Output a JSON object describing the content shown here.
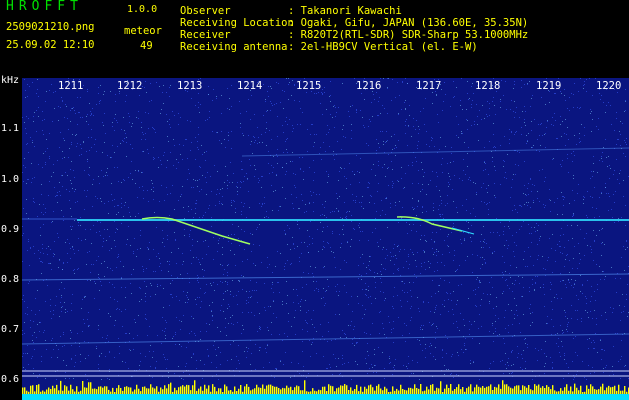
{
  "header": {
    "logo": "HROFFT",
    "version": "1.0.0",
    "file_name": "2509021210.png",
    "meteor_label": "meteor",
    "date_time": "25.09.02 12:10",
    "meteor_count": "49",
    "info": [
      {
        "label": "Observer",
        "value": ": Takanori Kawachi"
      },
      {
        "label": "Receiving Location",
        "value": ": Ogaki, Gifu, JAPAN (136.60E, 35.35N)"
      },
      {
        "label": "Receiver",
        "value": ": R820T2(RTL-SDR) SDR-Sharp 53.1000MHz"
      },
      {
        "label": "Receiving antenna",
        "value": ": 2el-HB9CV Vertical (el. E-W)"
      }
    ]
  },
  "spectrogram": {
    "unit": "kHz",
    "time_ticks": [
      "1211",
      "1212",
      "1213",
      "1214",
      "1215",
      "1216",
      "1217",
      "1218",
      "1219",
      "1220"
    ],
    "freq_ticks": [
      "1.1",
      "1.0",
      "0.9",
      "0.8",
      "0.7",
      "0.6"
    ],
    "colors": {
      "background": "#0a1580",
      "trace": "#30e0ff",
      "meteor": "#a0ff60",
      "bars": "#ffff00",
      "baseline": "#00e0ff"
    }
  }
}
